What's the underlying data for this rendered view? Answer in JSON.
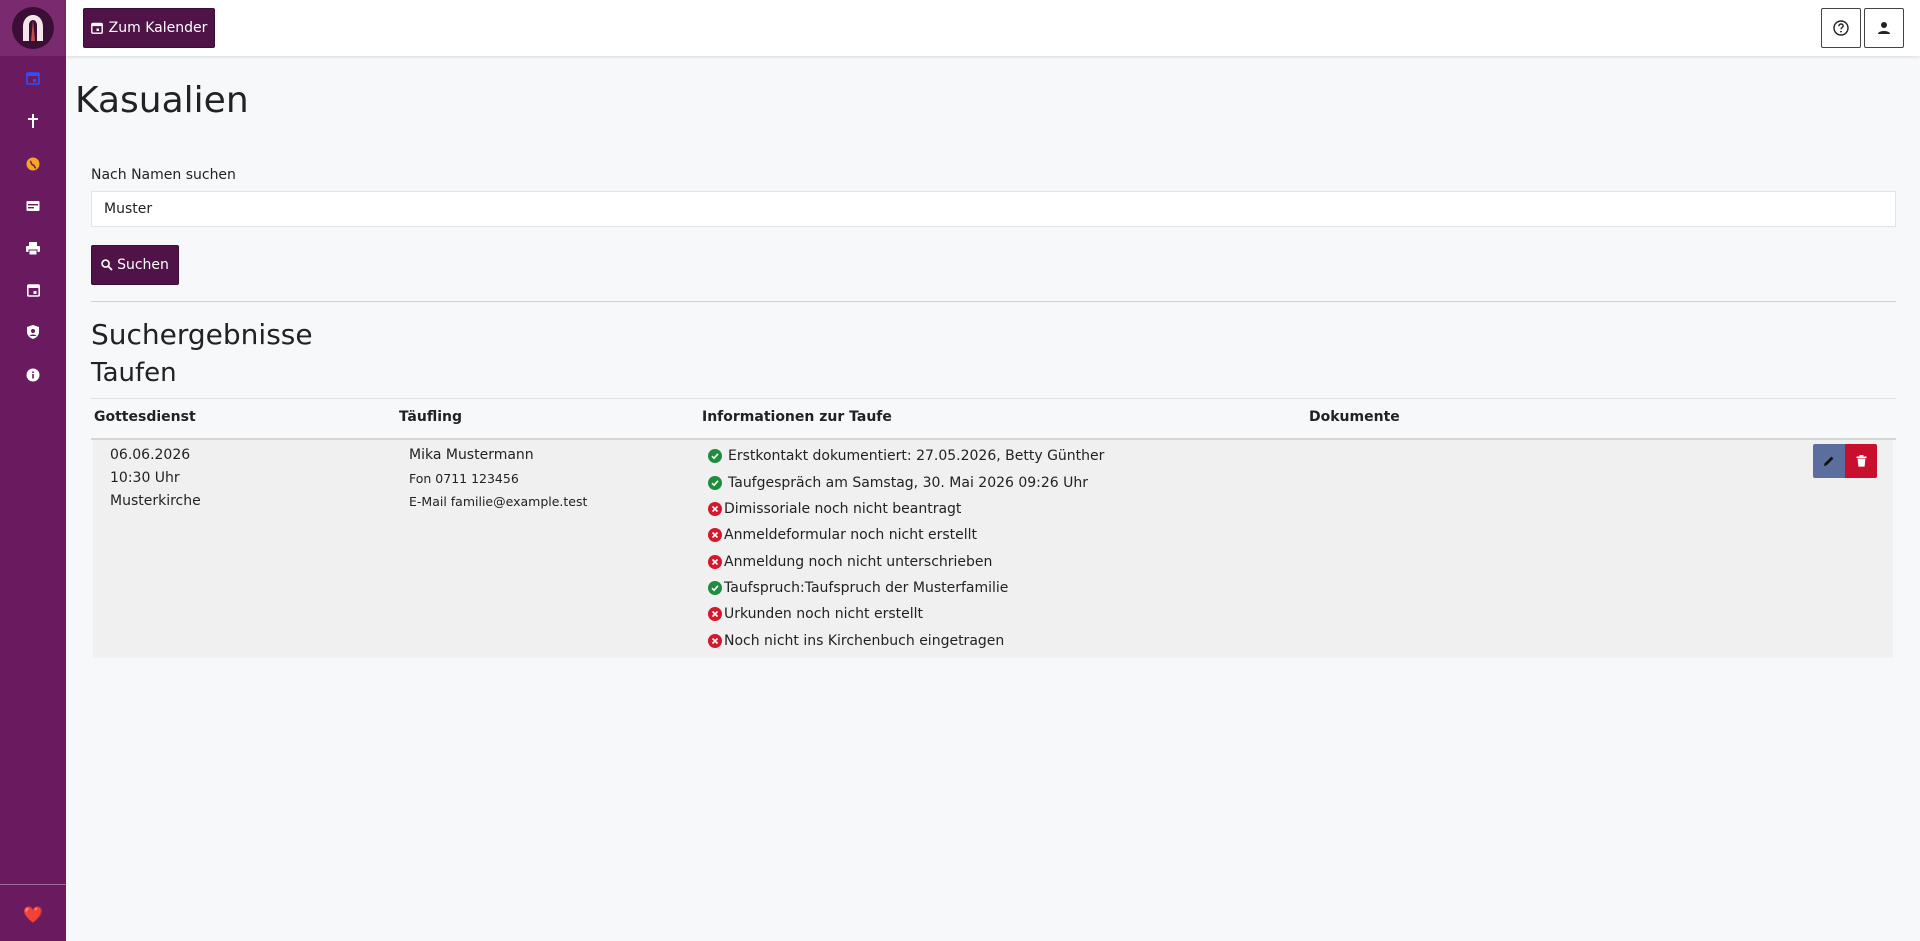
{
  "sidebar": {
    "logo": "church-logo",
    "items": [
      {
        "icon": "calendar-icon"
      },
      {
        "icon": "cross-icon"
      },
      {
        "icon": "globe-icon"
      },
      {
        "icon": "card-icon"
      },
      {
        "icon": "printer-icon"
      },
      {
        "icon": "calendar-day-icon"
      },
      {
        "icon": "shield-user-icon"
      },
      {
        "icon": "info-icon"
      }
    ],
    "footer_icon": "heart-icon",
    "footer_text": "❤️"
  },
  "topbar": {
    "calendar_button": "Zum Kalender",
    "help_icon": "question-circle-icon",
    "user_icon": "user-icon"
  },
  "page": {
    "title": "Kasualien"
  },
  "search": {
    "label": "Nach Namen suchen",
    "value": "Muster",
    "button": "Suchen"
  },
  "results": {
    "heading": "Suchergebnisse",
    "section": "Taufen",
    "columns": [
      "Gottesdienst",
      "Täufling",
      "Informationen zur Taufe",
      "Dokumente"
    ],
    "rows": [
      {
        "gottesdienst": [
          "06.06.2026",
          "10:30 Uhr",
          "Musterkirche"
        ],
        "taeufling": {
          "name": "Mika Mustermann",
          "phone": "Fon 0711 123456",
          "email": "E-Mail familie@example.test"
        },
        "info": [
          {
            "status": "ok",
            "text": "Erstkontakt dokumentiert: 27.05.2026, Betty Günther"
          },
          {
            "status": "ok",
            "text": "Taufgespräch am Samstag, 30. Mai 2026 09:26 Uhr"
          },
          {
            "status": "error",
            "text": "Dimissoriale noch nicht beantragt"
          },
          {
            "status": "error",
            "text": "Anmeldeformular noch nicht erstellt"
          },
          {
            "status": "error",
            "text": "Anmeldung noch nicht unterschrieben"
          },
          {
            "status": "ok",
            "text": "Taufspruch:Taufspruch der Musterfamilie"
          },
          {
            "status": "error",
            "text": "Urkunden noch nicht erstellt"
          },
          {
            "status": "error",
            "text": "Noch nicht ins Kirchenbuch eingetragen"
          }
        ],
        "actions": [
          {
            "icon": "pencil-icon"
          },
          {
            "icon": "trash-icon"
          }
        ]
      }
    ]
  },
  "colors": {
    "sidebar": "#6a1b5f",
    "primary_button": "#4f1347",
    "status_ok": "#1e8e3e",
    "status_error": "#d3192b",
    "edit_button": "#5b6e9e",
    "delete_button": "#c8102e"
  }
}
